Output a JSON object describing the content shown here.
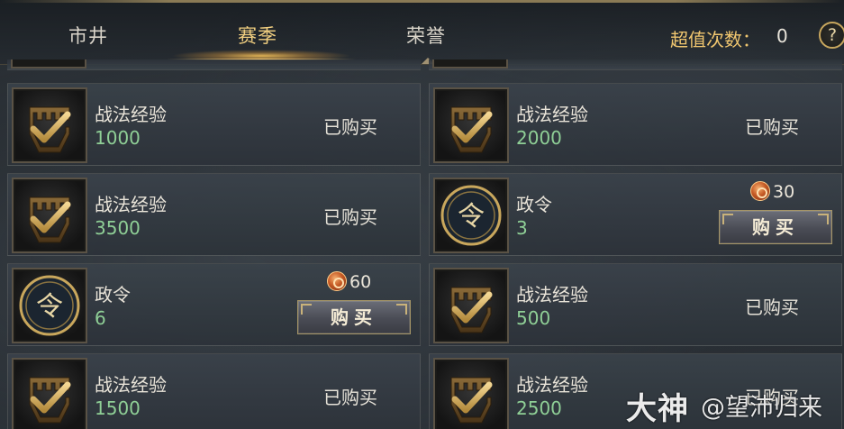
{
  "tabs": [
    {
      "label": "市井",
      "active": false
    },
    {
      "label": "赛季",
      "active": true
    },
    {
      "label": "荣誉",
      "active": false
    }
  ],
  "deal": {
    "label": "超值次数：",
    "count": "0"
  },
  "help": {
    "label": "?"
  },
  "status_purchased": "已购买",
  "buy_label": "购买",
  "items": [
    {
      "name": "战法经验",
      "qty": "1000",
      "icon": "tactic-exp-icon",
      "state": "purchased"
    },
    {
      "name": "战法经验",
      "qty": "2000",
      "icon": "tactic-exp-icon",
      "state": "purchased"
    },
    {
      "name": "战法经验",
      "qty": "3500",
      "icon": "tactic-exp-icon",
      "state": "purchased"
    },
    {
      "name": "政令",
      "qty": "3",
      "icon": "decree-icon",
      "state": "buy",
      "price": "30"
    },
    {
      "name": "政令",
      "qty": "6",
      "icon": "decree-icon",
      "state": "buy",
      "price": "60"
    },
    {
      "name": "战法经验",
      "qty": "500",
      "icon": "tactic-exp-icon",
      "state": "purchased"
    },
    {
      "name": "战法经验",
      "qty": "1500",
      "icon": "tactic-exp-icon",
      "state": "purchased"
    },
    {
      "name": "战法经验",
      "qty": "2500",
      "icon": "tactic-exp-icon",
      "state": "purchased"
    }
  ],
  "watermark": {
    "brand": "大神",
    "user": "@望沛归来"
  },
  "colors": {
    "accent_gold": "#f1cf80",
    "qty_green": "#8fcf96",
    "bg": "#2c3238"
  }
}
